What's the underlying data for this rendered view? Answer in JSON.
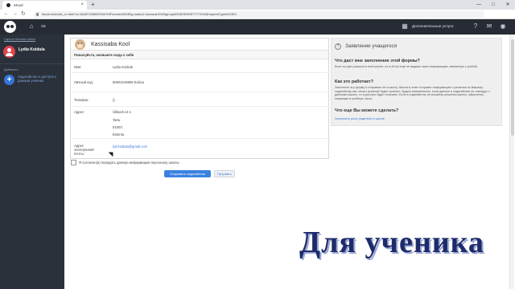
{
  "browser": {
    "tab_title": "eKool",
    "tab_close": "×",
    "newtab": "+",
    "url": "ekool.eu/index_ru.html?a=1645719860291#/%3Fscreenld%3Dg.mainu2.showcard%26groupld%3D3000977774%26requestTypeld%3D1",
    "back": "←",
    "forward": "→",
    "reload": "↻",
    "controls": [
      "—",
      "□",
      "✕"
    ]
  },
  "topbar": {
    "services_label": "Дополнительные услуги"
  },
  "sidebar": {
    "hide_menu": "Скрыть боковое меню",
    "user_name": "Lydia Koidula",
    "add_label": "Добавить",
    "add_text": "Ходатайство о доступе к данным ученика"
  },
  "card": {
    "title": "Kassisaba Kool",
    "subtitle": "Пожалуйста, напишите сюда о себе",
    "fields": {
      "name_label": "Имя:",
      "name_value": "Lydia Koidula",
      "code_label": "Личный код:",
      "code_value": "60001019906 Eclicia",
      "phone_label": "Телефон:",
      "phone_value": "()",
      "address_label": "Адрес:",
      "address_line1": "Ülikooli 14-1",
      "address_line2": "Tartu",
      "address_line3": "51003",
      "address_line4": "Estonia",
      "email_label": "Адрес электронной почты:",
      "email_value": "lyd.koidula@gmail.com"
    }
  },
  "consent": {
    "label": "Я согласен(а) передать данную информацию персоналу школы"
  },
  "buttons": {
    "send": "Отправить ходатайство",
    "cancel": "Прервать"
  },
  "info": {
    "title": "Заявление учащегося",
    "q1": "Что даст мне заполнение этой формы?",
    "a1": "Если ты уже учишься в этой школе, но в eKool ещё не видишь свою информацию, связанную с учебой.",
    "q2": "Как это работает?",
    "a2": "Заполните эту форму и отправьте ее в школу. Школа в ответ отправит информацию о решении по Вашему ходатайству как только решение будет принято. Будьте внимательны: если данные в ходатайстве не совпадут с данными школы, то в доступе будет отказано. Если в ходатайство не вложены решения школы, обратитесь напрямую в учебную часть.",
    "q3": "Что еще Вы можете сделать?",
    "link": "Запросить роль родителя в школе"
  },
  "overlay": {
    "text": "Для ученика"
  },
  "colors": {
    "topbar": "#262b34",
    "sidebar": "#2b313a",
    "accent": "#3477d7"
  }
}
